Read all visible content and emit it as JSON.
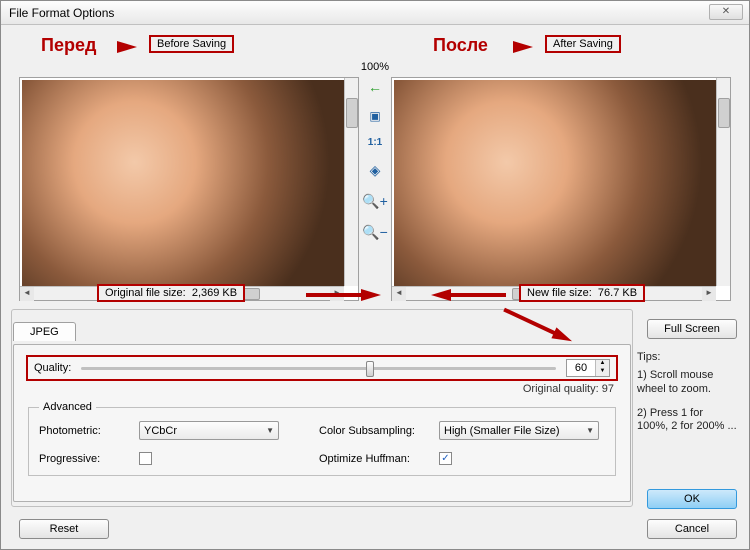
{
  "window": {
    "title": "File Format Options"
  },
  "annotations": {
    "before_ru": "Перед",
    "after_ru": "После",
    "before_en": "Before Saving",
    "after_en": "After Saving"
  },
  "zoom_percent": "100%",
  "file_sizes": {
    "original_label": "Original file size:",
    "original_value": "2,369 KB",
    "new_label": "New file size:",
    "new_value": "76.7 KB"
  },
  "tools": {
    "onetoone": "1:1"
  },
  "tabs": {
    "jpeg": "JPEG"
  },
  "buttons": {
    "full_screen": "Full Screen",
    "ok": "OK",
    "cancel": "Cancel",
    "reset": "Reset"
  },
  "quality": {
    "label": "Quality:",
    "value": "60",
    "percent_pos": 60,
    "original_label": "Original quality:",
    "original_value": "97"
  },
  "advanced": {
    "legend": "Advanced",
    "photometric_label": "Photometric:",
    "photometric_value": "YCbCr",
    "subsampling_label": "Color Subsampling:",
    "subsampling_value": "High (Smaller File Size)",
    "progressive_label": "Progressive:",
    "progressive_checked": false,
    "huffman_label": "Optimize Huffman:",
    "huffman_checked": true
  },
  "tips": {
    "heading": "Tips:",
    "line1": "1) Scroll mouse wheel to zoom.",
    "line2": "2) Press 1 for 100%, 2 for 200% ..."
  }
}
